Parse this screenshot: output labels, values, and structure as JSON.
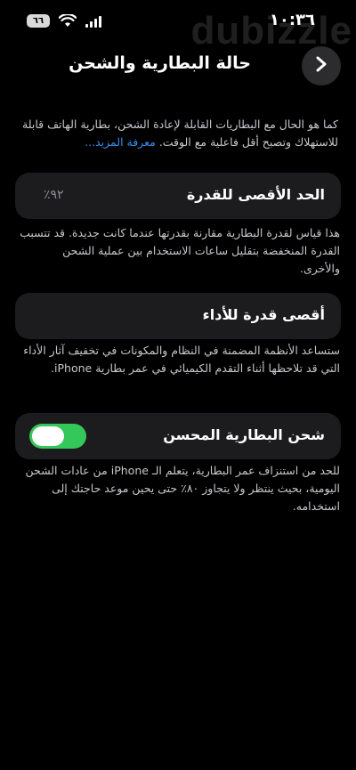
{
  "status_bar": {
    "battery_level": "٦٦",
    "time": "١٠:٣٦"
  },
  "watermark": "dubizzle",
  "header": {
    "title": "حالة البطارية والشحن"
  },
  "intro": {
    "text": "كما هو الحال مع البطاريات القابلة لإعادة الشحن، بطارية الهاتف قابلة للاستهلاك وتصبح أقل فاعلية مع الوقت.",
    "link": "معرفة المزيد..."
  },
  "max_capacity": {
    "label": "الحد الأقصى للقدرة",
    "value": "٪٩٢",
    "description": "هذا قياس لقدرة البطارية مقارنة بقدرتها عندما كانت جديدة. قد تتسبب القدرة المنخفضة بتقليل ساعات الاستخدام بين عملية الشحن والأخرى."
  },
  "peak_performance": {
    "label": "أقصى قدرة للأداء",
    "description": "ستساعد الأنظمة المضمنة في النظام والمكونات في تخفيف آثار الأداء التي قد تلاحظها أثناء التقدم الكيميائي في عمر بطارية iPhone."
  },
  "optimized_charging": {
    "label": "شحن البطارية المحسن",
    "enabled": true,
    "description": "للحد من استنزاف عمر البطارية، يتعلم الـ iPhone من عادات الشحن اليومية، بحيث ينتظر ولا يتجاوز ٨٠٪ حتى يحين موعد حاجتك إلى استخدامه."
  },
  "colors": {
    "background": "#000000",
    "card": "#1c1c1e",
    "toggle_on": "#34c759",
    "link": "#3a8df0"
  }
}
